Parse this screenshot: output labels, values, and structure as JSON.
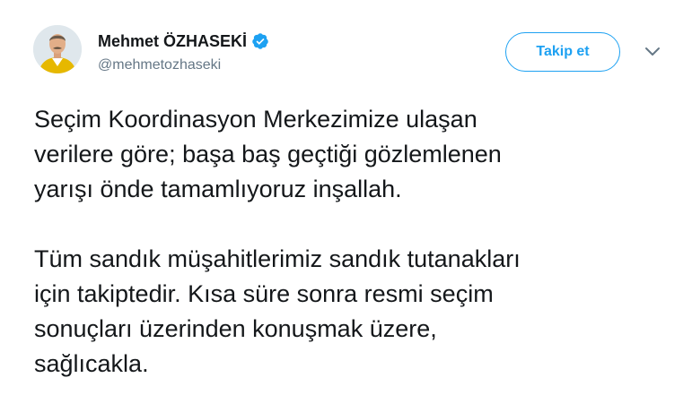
{
  "author": {
    "display_name": "Mehmet ÖZHASEKİ",
    "handle": "@mehmetozhaseki",
    "verified": true,
    "avatar_icon": "profile-photo"
  },
  "actions": {
    "follow_label": "Takip et",
    "more_icon": "chevron-down-icon"
  },
  "tweet": {
    "paragraph_1": "Seçim Koordinasyon Merkezimize ulaşan\nverilere göre; başa baş geçtiği gözlemlenen\nyarışı önde tamamlıyoruz inşallah.",
    "paragraph_2": "Tüm sandık müşahitlerimiz sandık tutanakları\niçin takiptedir. Kısa süre sonra resmi seçim\nsonuçları üzerinden konuşmak üzere,\nsağlıcakla."
  },
  "colors": {
    "accent": "#1da1f2",
    "text": "#14171a",
    "secondary_text": "#657786"
  }
}
